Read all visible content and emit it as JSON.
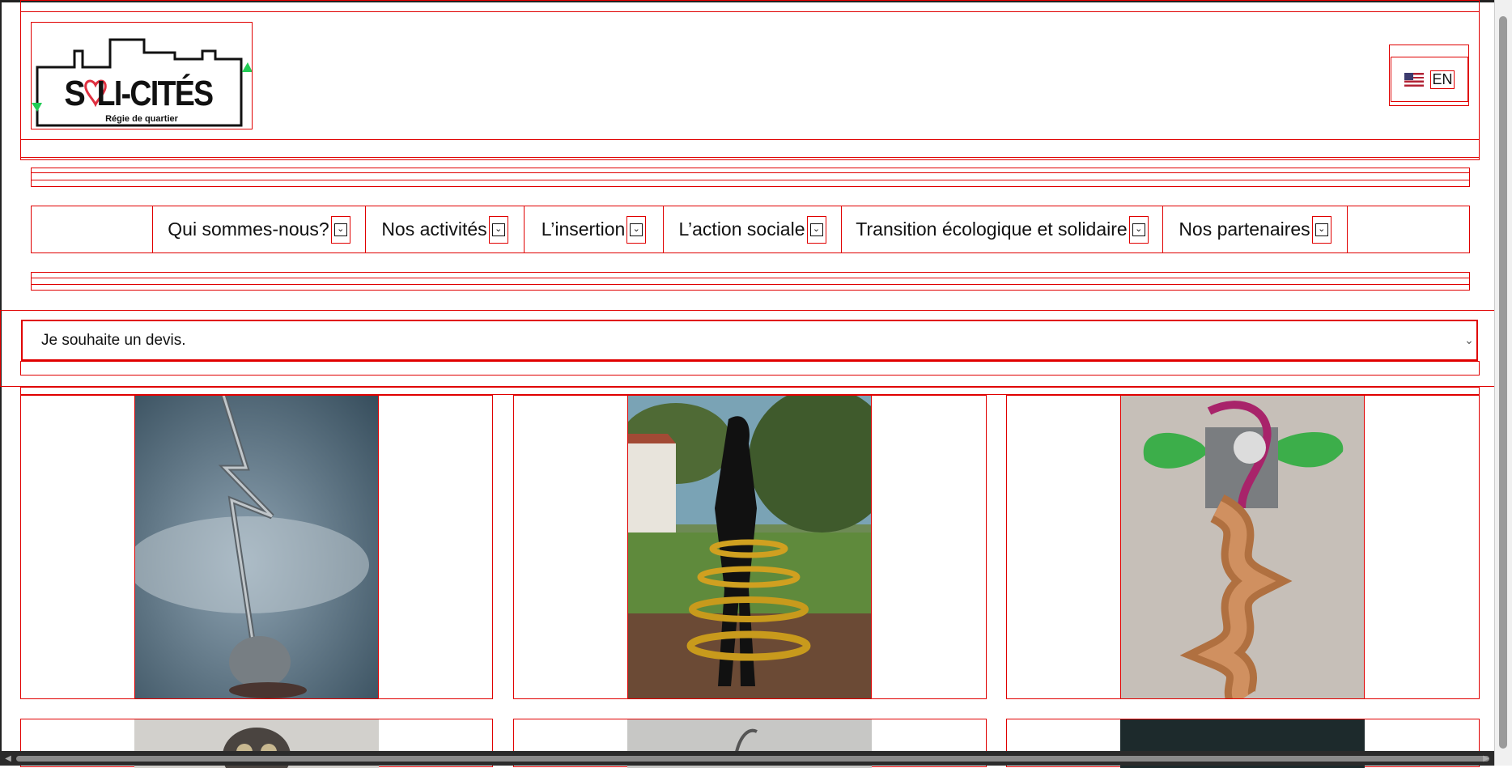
{
  "logo": {
    "text_part1": "S",
    "text_part2": "LI-CITÉS",
    "tagline": "Régie de quartier"
  },
  "language": {
    "label": "EN",
    "flag_icon": "us-flag-icon"
  },
  "nav": {
    "items": [
      {
        "label": "Qui sommes-nous?"
      },
      {
        "label": "Nos activités"
      },
      {
        "label": "L’insertion"
      },
      {
        "label": "L’action sociale"
      },
      {
        "label": "Transition écologique et solidaire"
      },
      {
        "label": "Nos partenaires"
      }
    ],
    "dropdown_icon": "chevron-down-icon"
  },
  "quote_select": {
    "value": "Je souhaite un devis."
  },
  "gallery": {
    "row1": [
      "lightning-sculpture",
      "mannequin-rings-sculpture",
      "twisted-wood-totem-sculpture"
    ],
    "row2": [
      "owl-sculpture",
      "grey-sculpture",
      "dark-sculpture"
    ]
  },
  "colors": {
    "outline": "#e00000",
    "heart": "#e03040",
    "logo_green": "#22cc55"
  }
}
